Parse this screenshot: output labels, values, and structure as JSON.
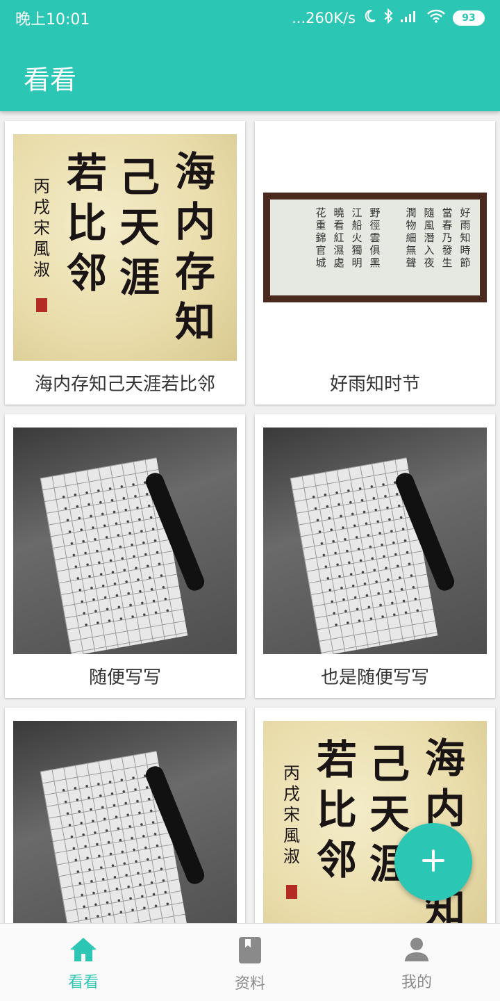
{
  "status_bar": {
    "time": "晚上10:01",
    "network_speed": "...260K/s",
    "battery": "93"
  },
  "app_bar": {
    "title": "看看"
  },
  "cards": [
    {
      "caption": "海内存知己天涯若比邻",
      "thumbnail": "calligraphy-scroll"
    },
    {
      "caption": "好雨知时节",
      "thumbnail": "poem-scroll"
    },
    {
      "caption": "随便写写",
      "thumbnail": "copybook-photo"
    },
    {
      "caption": "也是随便写写",
      "thumbnail": "copybook-photo"
    },
    {
      "caption": "",
      "thumbnail": "copybook-photo"
    },
    {
      "caption": "",
      "thumbnail": "calligraphy-scroll"
    }
  ],
  "calligraphy": {
    "columns": [
      "海内存知",
      "己天涯",
      "若比邻"
    ],
    "signature": "丙戌宋風淑"
  },
  "poem": {
    "columns": [
      "好雨知時節",
      "當春乃發生",
      "隨風潛入夜",
      "潤物細無聲",
      "野徑雲俱黑",
      "江船火獨明",
      "曉看紅濕處",
      "花重錦官城"
    ]
  },
  "fab": {
    "icon": "plus-icon"
  },
  "bottom_nav": {
    "items": [
      {
        "label": "看看",
        "icon": "home-icon",
        "active": true
      },
      {
        "label": "资料",
        "icon": "book-icon",
        "active": false
      },
      {
        "label": "我的",
        "icon": "person-icon",
        "active": false
      }
    ]
  },
  "colors": {
    "primary": "#2bc6b4",
    "inactive": "#8a8a8a"
  }
}
